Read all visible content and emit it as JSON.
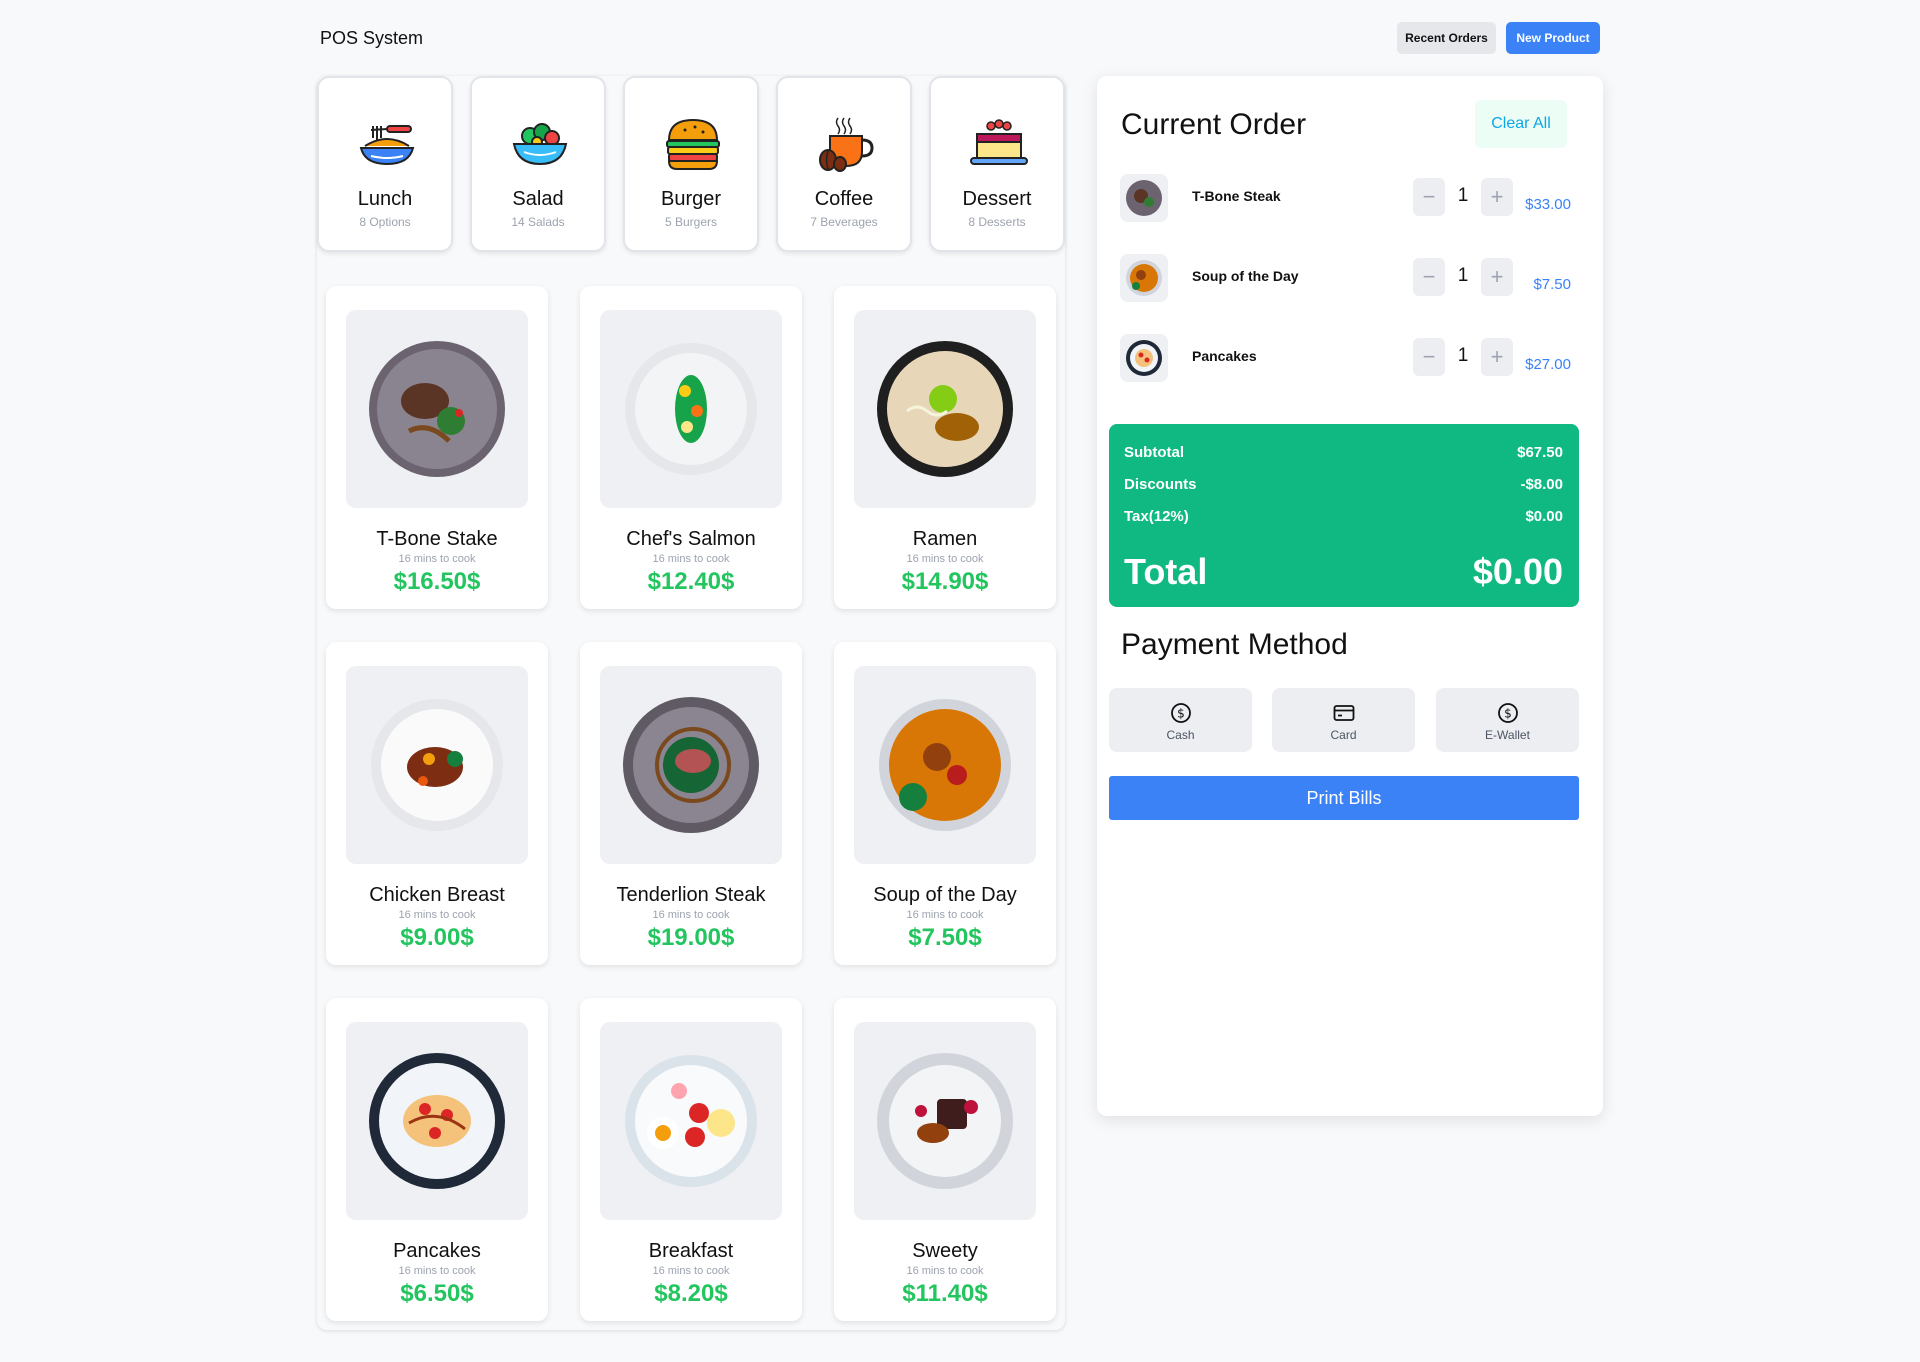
{
  "header": {
    "title": "POS System",
    "recent_orders_label": "Recent Orders",
    "new_product_label": "New Product"
  },
  "categories": [
    {
      "name": "Lunch",
      "sub": "8 Options",
      "icon": "noodles-icon"
    },
    {
      "name": "Salad",
      "sub": "14 Salads",
      "icon": "salad-bowl-icon"
    },
    {
      "name": "Burger",
      "sub": "5 Burgers",
      "icon": "burger-icon"
    },
    {
      "name": "Coffee",
      "sub": "7 Beverages",
      "icon": "coffee-cup-icon"
    },
    {
      "name": "Dessert",
      "sub": "8 Desserts",
      "icon": "cake-icon"
    }
  ],
  "products": [
    {
      "name": "T-Bone Stake",
      "time": "16 mins to cook",
      "price": "$16.50$"
    },
    {
      "name": "Chef's Salmon",
      "time": "16 mins to cook",
      "price": "$12.40$"
    },
    {
      "name": "Ramen",
      "time": "16 mins to cook",
      "price": "$14.90$"
    },
    {
      "name": "Chicken Breast",
      "time": "16 mins to cook",
      "price": "$9.00$"
    },
    {
      "name": "Tenderlion Steak",
      "time": "16 mins to cook",
      "price": "$19.00$"
    },
    {
      "name": "Soup of the Day",
      "time": "16 mins to cook",
      "price": "$7.50$"
    },
    {
      "name": "Pancakes",
      "time": "16 mins to cook",
      "price": "$6.50$"
    },
    {
      "name": "Breakfast",
      "time": "16 mins to cook",
      "price": "$8.20$"
    },
    {
      "name": "Sweety",
      "time": "16 mins to cook",
      "price": "$11.40$"
    }
  ],
  "order": {
    "title": "Current Order",
    "clear_label": "Clear All",
    "items": [
      {
        "name": "T-Bone Steak",
        "qty": "1",
        "price": "$33.00"
      },
      {
        "name": "Soup of the Day",
        "qty": "1",
        "price": "$7.50"
      },
      {
        "name": "Pancakes",
        "qty": "1",
        "price": "$27.00"
      }
    ],
    "minus_symbol": "−",
    "plus_symbol": "+",
    "subtotal_label": "Subtotal",
    "subtotal_value": "$67.50",
    "discounts_label": "Discounts",
    "discounts_value": "-$8.00",
    "tax_label": "Tax(12%)",
    "tax_value": "$0.00",
    "total_label": "Total",
    "total_value": "$0.00"
  },
  "payment": {
    "title": "Payment Method",
    "methods": [
      {
        "label": "Cash",
        "icon": "dollar-circle-icon"
      },
      {
        "label": "Card",
        "icon": "credit-card-icon"
      },
      {
        "label": "E-Wallet",
        "icon": "dollar-circle-icon"
      }
    ],
    "print_label": "Print Bills"
  },
  "colors": {
    "accent_blue": "#3b82f6",
    "price_green": "#22c55e",
    "totals_green": "#10b981"
  }
}
